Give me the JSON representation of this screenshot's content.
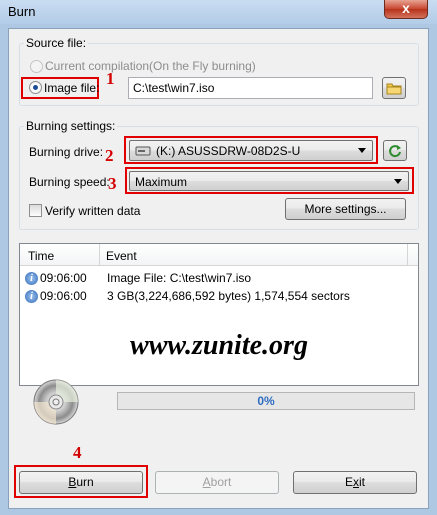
{
  "window": {
    "title": "Burn",
    "close_glyph": "x"
  },
  "source": {
    "legend": "Source file:",
    "current_label": "Current compilation(On the Fly burning)",
    "image_label": "Image file:",
    "image_path": "C:\\test\\win7.iso",
    "browse_icon": "folder-icon"
  },
  "settings": {
    "legend": "Burning settings:",
    "drive_label": "Burning drive:",
    "drive_value": "(K:) ASUSSDRW-08D2S-U",
    "drive_icon": "optical-drive-icon",
    "refresh_icon": "refresh-icon",
    "speed_label": "Burning speed:",
    "speed_value": "Maximum",
    "verify_label": "Verify written data",
    "verify_checked": false,
    "more_button": "More settings..."
  },
  "log": {
    "columns": [
      "Time",
      "Event"
    ],
    "rows": [
      {
        "time": "09:06:00",
        "event": "Image File:  C:\\test\\win7.iso"
      },
      {
        "time": "09:06:00",
        "event": "3 GB(3,224,686,592 bytes)  1,574,554 sectors"
      }
    ]
  },
  "watermark": "www.zunite.org",
  "progress": {
    "percent": 0,
    "label": "0%"
  },
  "buttons": {
    "burn_pre": "",
    "burn_key": "B",
    "burn_post": "urn",
    "abort_pre": "",
    "abort_key": "A",
    "abort_post": "bort",
    "exit_pre": "E",
    "exit_key": "x",
    "exit_post": "it"
  },
  "annotations": [
    "1",
    "2",
    "3",
    "4"
  ],
  "colors": {
    "highlight_box": "#e00000",
    "progress_text": "#2f6cc0",
    "title_bar": "#b9d1ea"
  }
}
